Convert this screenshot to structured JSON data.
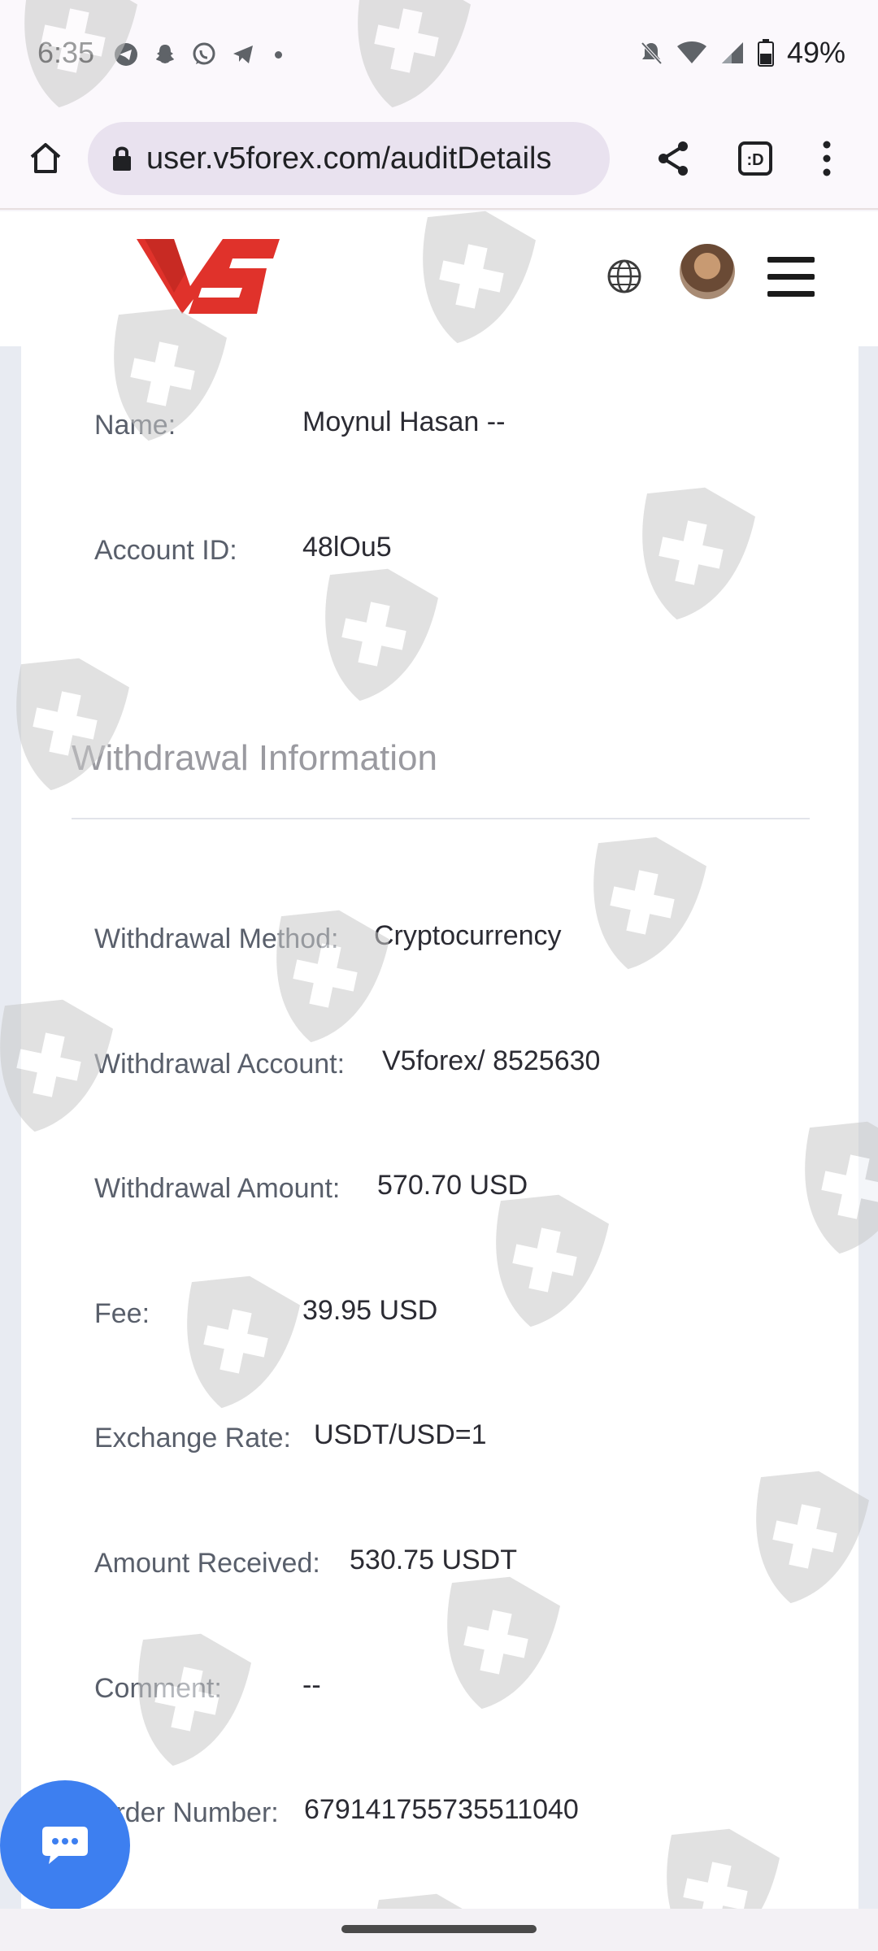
{
  "status_bar": {
    "time": "6:35",
    "battery": "49%",
    "notification_icons": [
      "telegram-icon",
      "snapchat-icon",
      "whatsapp-icon",
      "telegram-icon"
    ],
    "system_icons": [
      "bell-off-icon",
      "wifi-icon",
      "signal-icon",
      "battery-icon"
    ]
  },
  "browser": {
    "url": "user.v5forex.com/auditDetails",
    "tab_count_label": ":D"
  },
  "header": {
    "logo_text": "V5",
    "brand_color": "#e0322b"
  },
  "account": {
    "name_label": "Name:",
    "name_value": "Moynul Hasan --",
    "id_label": "Account ID:",
    "id_value": "48lOu5"
  },
  "withdrawal": {
    "section_title": "Withdrawal Information",
    "rows": [
      {
        "label": "Withdrawal Method:",
        "value": "Cryptocurrency"
      },
      {
        "label": "Withdrawal Account:",
        "value": "V5forex/ 8525630"
      },
      {
        "label": "Withdrawal Amount:",
        "value": "570.70 USD"
      },
      {
        "label": "Fee:",
        "value": "39.95 USD"
      },
      {
        "label": "Exchange Rate:",
        "value": "USDT/USD=1"
      },
      {
        "label": "Amount Received:",
        "value": "530.75 USDT"
      },
      {
        "label": "Comment:",
        "value": "--"
      },
      {
        "label": "Order Number:",
        "value": "679141755735511040"
      }
    ]
  },
  "chat": {
    "icon": "chat-bubble-icon",
    "color": "#3d7ff0"
  }
}
